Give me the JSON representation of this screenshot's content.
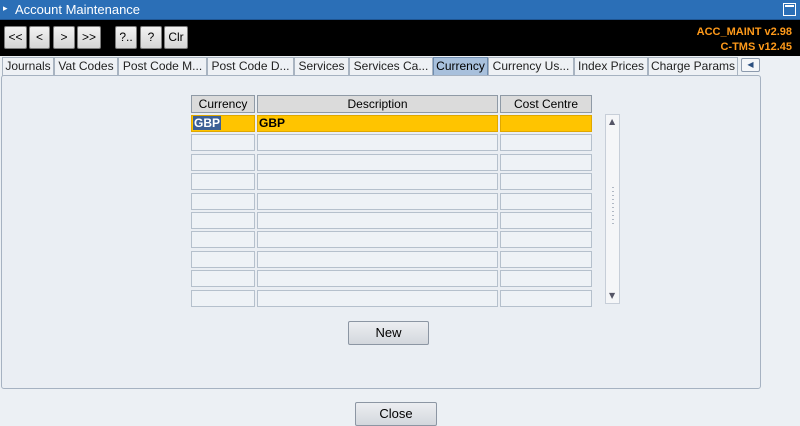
{
  "window": {
    "title": "Account Maintenance"
  },
  "toolbar": {
    "buttons": [
      "<<",
      "<",
      ">",
      ">>",
      "?..",
      "?",
      "Clr"
    ],
    "version_line1": "ACC_MAINT v2.98",
    "version_line2": "C-TMS v12.45"
  },
  "tabs": [
    {
      "label": "Journals"
    },
    {
      "label": "Vat Codes"
    },
    {
      "label": "Post Code M..."
    },
    {
      "label": "Post Code D..."
    },
    {
      "label": "Services"
    },
    {
      "label": "Services Ca..."
    },
    {
      "label": "Currency",
      "active": true
    },
    {
      "label": "Currency Us..."
    },
    {
      "label": "Index Prices"
    },
    {
      "label": "Charge Params"
    }
  ],
  "grid": {
    "columns": [
      "Currency",
      "Description",
      "Cost Centre"
    ],
    "rows": [
      {
        "currency": "GBP",
        "description": "GBP",
        "cost_centre": ""
      }
    ]
  },
  "buttons": {
    "new": "New",
    "close": "Close"
  },
  "colors": {
    "titlebar": "#2b6fb7",
    "version_text": "#ff9a1a",
    "selected_row": "#ffc400",
    "active_tab": "#a8c0dc"
  }
}
